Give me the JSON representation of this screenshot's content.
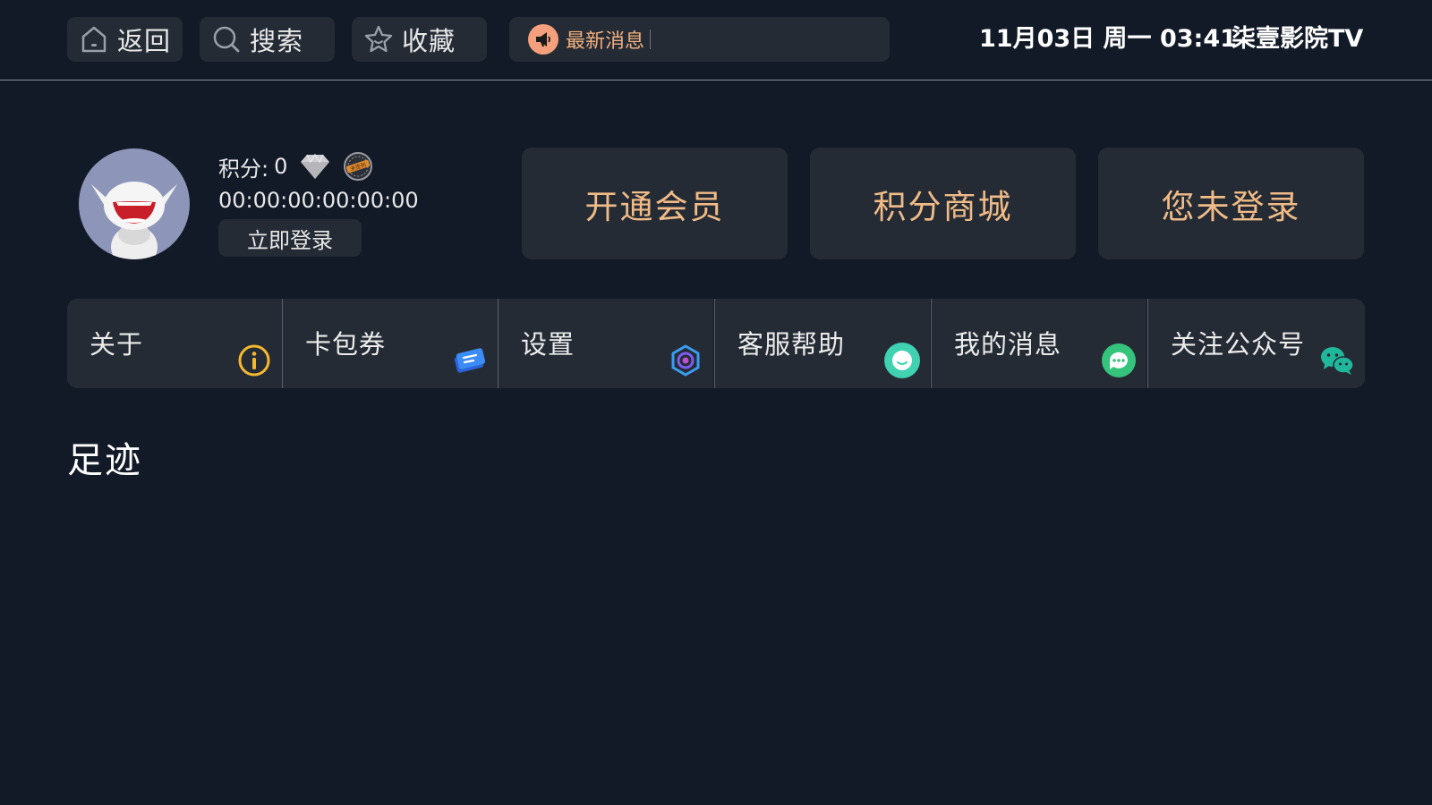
{
  "topbar": {
    "back_label": "返回",
    "search_label": "搜索",
    "favorites_label": "收藏",
    "news_label": "最新消息",
    "datetime": "11月03日 周一 03:41",
    "brand": "柒壹影院TV"
  },
  "profile": {
    "points_label": "积分:",
    "points_value": "0",
    "mac_address": "00:00:00:00:00:00",
    "login_button": "立即登录",
    "stamp_text": "未签到"
  },
  "actions": {
    "vip": "开通会员",
    "mall": "积分商城",
    "login_status": "您未登录"
  },
  "menu": {
    "items": [
      {
        "label": "关于",
        "icon": "info-icon",
        "color": "#f5b82e"
      },
      {
        "label": "卡包券",
        "icon": "ticket-icon",
        "color": "#3b82f6"
      },
      {
        "label": "设置",
        "icon": "gear-icon",
        "color": "#7c5cf0"
      },
      {
        "label": "客服帮助",
        "icon": "support-chat-icon",
        "color": "#3fd1b0"
      },
      {
        "label": "我的消息",
        "icon": "message-icon",
        "color": "#34c47c"
      },
      {
        "label": "关注公众号",
        "icon": "wechat-icon",
        "color": "#1fb89a"
      }
    ]
  },
  "footprints": {
    "title": "足迹"
  },
  "colors": {
    "background": "#121a27",
    "card": "#252b35",
    "accent_gold": "#f0bb87",
    "news_orange": "#f4a07c"
  }
}
